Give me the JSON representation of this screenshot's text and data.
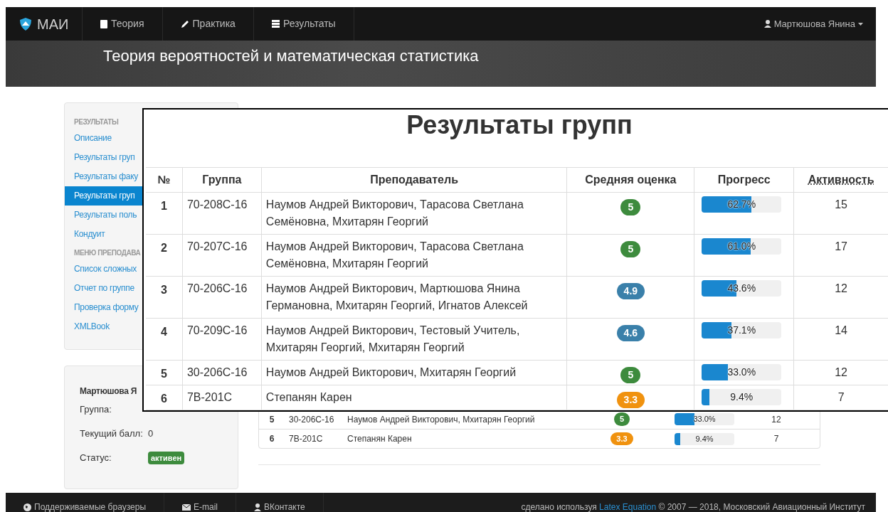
{
  "navbar": {
    "brand": "МАИ",
    "items": [
      {
        "label": "Теория"
      },
      {
        "label": "Практика"
      },
      {
        "label": "Результаты"
      }
    ],
    "user": "Мартюшова Янина"
  },
  "banner": {
    "title": "Теория вероятностей и математическая статистика"
  },
  "sidebar": {
    "sections": [
      {
        "heading": "РЕЗУЛЬТАТЫ",
        "items": [
          {
            "label": "Описание",
            "selected": false
          },
          {
            "label": "Результаты груп",
            "selected": false
          },
          {
            "label": "Результаты факу",
            "selected": false
          },
          {
            "label": "Результаты груп",
            "selected": true
          },
          {
            "label": "Результаты поль",
            "selected": false
          },
          {
            "label": "Кондуит",
            "selected": false
          }
        ]
      },
      {
        "heading": "МЕНЮ ПРЕПОДАВА",
        "items": [
          {
            "label": "Список сложных",
            "selected": false
          },
          {
            "label": "Отчет по группе",
            "selected": false
          },
          {
            "label": "Проверка форму",
            "selected": false
          },
          {
            "label": "XMLBook",
            "selected": false
          }
        ]
      }
    ]
  },
  "profile": {
    "name": "Мартюшова Я",
    "fields": [
      {
        "label": "Группа:"
      },
      {
        "label": "Текущий балл:",
        "value": "0"
      },
      {
        "label": "Статус:",
        "badge": "активен"
      }
    ]
  },
  "page_table": {
    "rows": [
      {
        "no": "5",
        "group": "30-206С-16",
        "teacher": "Наумов Андрей Викторович, Мхитарян Георгий",
        "grade": "5",
        "color": "#3d8b3d",
        "level": 0.33,
        "progress": "33.0%",
        "activity": "12"
      },
      {
        "no": "6",
        "group": "7В-201С",
        "teacher": "Степанян Карен",
        "grade": "3.3",
        "color": "#f0920f",
        "level": 0.094,
        "progress": "9.4%",
        "activity": "7"
      }
    ]
  },
  "zoom_panel": {
    "title": "Результаты групп",
    "columns": [
      "№",
      "Группа",
      "Преподаватель",
      "Средняя оценка",
      "Прогресс",
      "Активность"
    ],
    "rows": [
      {
        "no": "1",
        "group": "70-208С-16",
        "teacher": "Наумов Андрей Викторович, Тарасова Светлана Семёновна, Мхитарян Георгий",
        "grade": "5",
        "color": "#3d8b3d",
        "level": 0.627,
        "progress": "62.7%",
        "activity": "15"
      },
      {
        "no": "2",
        "group": "70-207С-16",
        "teacher": "Наумов Андрей Викторович, Тарасова Светлана Семёновна, Мхитарян Георгий",
        "grade": "5",
        "color": "#3d8b3d",
        "level": 0.61,
        "progress": "61.0%",
        "activity": "17"
      },
      {
        "no": "3",
        "group": "70-206С-16",
        "teacher": "Наумов Андрей Викторович, Мартюшова Янина Германовна, Мхитарян Георгий, Игнатов Алексей",
        "grade": "4.9",
        "color": "#3a80aa",
        "level": 0.436,
        "progress": "43.6%",
        "activity": "12"
      },
      {
        "no": "4",
        "group": "70-209С-16",
        "teacher": "Наумов Андрей Викторович, Тестовый Учитель, Мхитарян Георгий, Мхитарян Георгий",
        "grade": "4.6",
        "color": "#3a80aa",
        "level": 0.371,
        "progress": "37.1%",
        "activity": "14"
      },
      {
        "no": "5",
        "group": "30-206С-16",
        "teacher": "Наумов Андрей Викторович, Мхитарян Георгий",
        "grade": "5",
        "color": "#3d8b3d",
        "level": 0.33,
        "progress": "33.0%",
        "activity": "12"
      },
      {
        "no": "6",
        "group": "7В-201С",
        "teacher": "Степанян Карен",
        "grade": "3.3",
        "color": "#f0920f",
        "level": 0.094,
        "progress": "9.4%",
        "activity": "7"
      }
    ]
  },
  "footer": {
    "links": [
      {
        "label": "Поддерживаемые браузеры"
      },
      {
        "label": "E-mail"
      },
      {
        "label": "ВКонтакте"
      }
    ],
    "credit_prefix": "сделано используя",
    "credit_link": "Latex Equation",
    "credit_suffix": "© 2007 — 2018, Московский Авиационный Институт"
  }
}
